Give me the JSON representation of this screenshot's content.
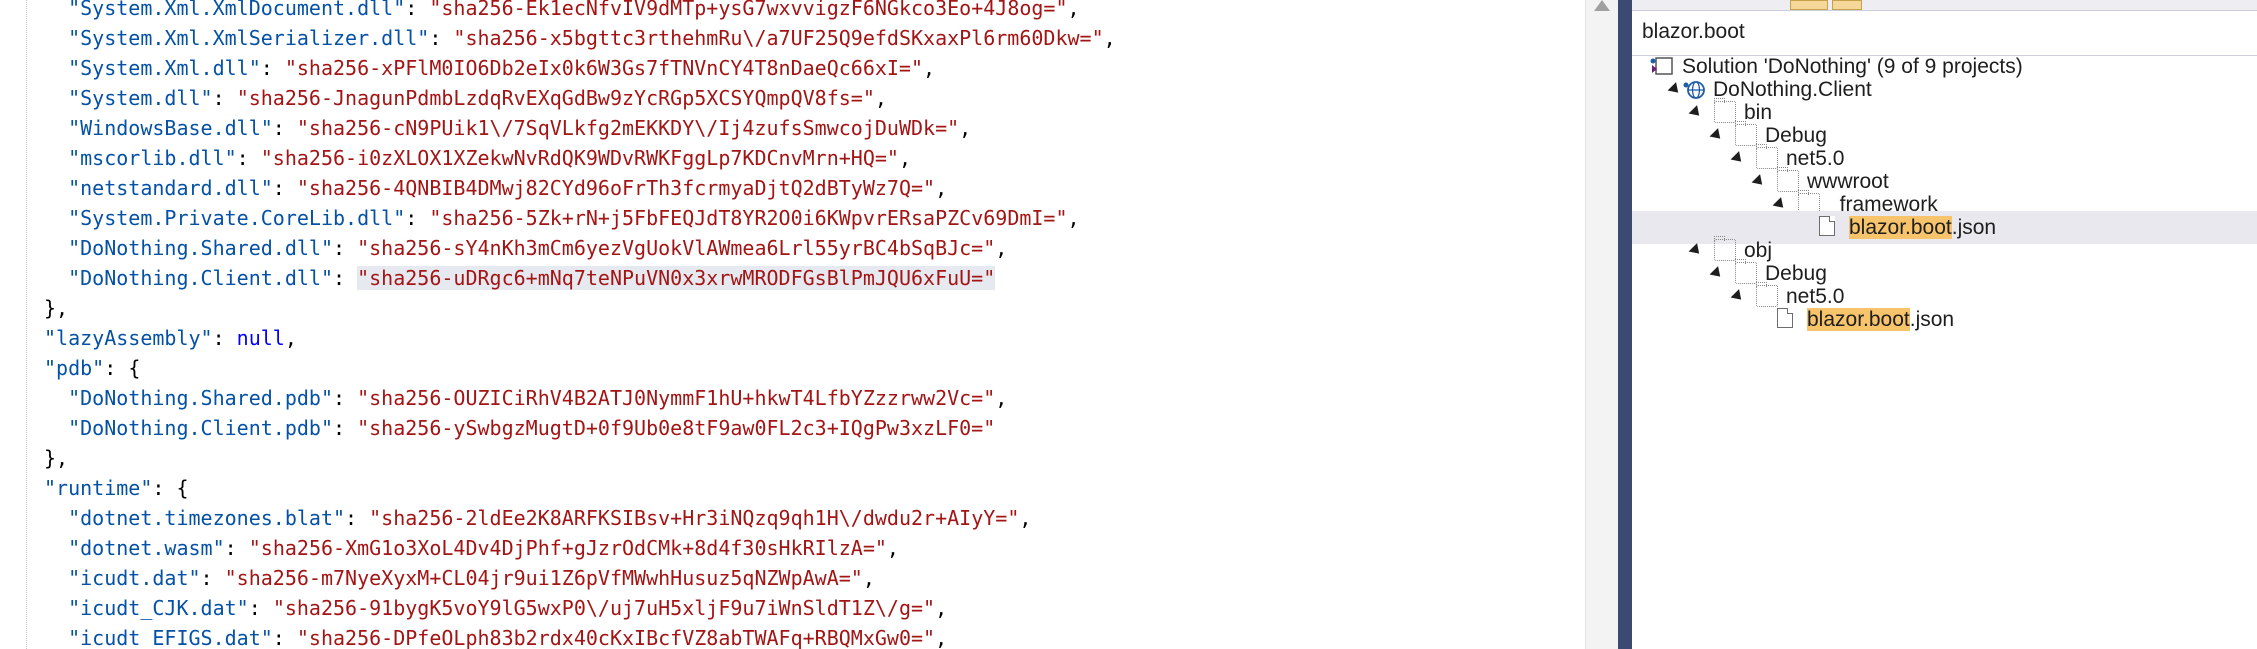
{
  "editor": {
    "lines": [
      {
        "indent": 1,
        "key": "\"System.Xml.XmlDocument.dll\"",
        "value": "\"sha256-Ek1ecNfvIV9dMTp+ysG7wxvvigzF6NGkco3Eo+4J8og=\"",
        "suffix": ","
      },
      {
        "indent": 1,
        "key": "\"System.Xml.XmlSerializer.dll\"",
        "value": "\"sha256-x5bgttc3rthehmRu\\/a7UF25Q9efdSKxaxPl6rm60Dkw=\"",
        "suffix": ","
      },
      {
        "indent": 1,
        "key": "\"System.Xml.dll\"",
        "value": "\"sha256-xPFlM0IO6Db2eIx0k6W3Gs7fTNVnCY4T8nDaeQc66xI=\"",
        "suffix": ","
      },
      {
        "indent": 1,
        "key": "\"System.dll\"",
        "value": "\"sha256-JnagunPdmbLzdqRvEXqGdBw9zYcRGp5XCSYQmpQV8fs=\"",
        "suffix": ","
      },
      {
        "indent": 1,
        "key": "\"WindowsBase.dll\"",
        "value": "\"sha256-cN9PUik1\\/7SqVLkfg2mEKKDY\\/Ij4zufsSmwcojDuWDk=\"",
        "suffix": ","
      },
      {
        "indent": 1,
        "key": "\"mscorlib.dll\"",
        "value": "\"sha256-i0zXLOX1XZekwNvRdQK9WDvRWKFggLp7KDCnvMrn+HQ=\"",
        "suffix": ","
      },
      {
        "indent": 1,
        "key": "\"netstandard.dll\"",
        "value": "\"sha256-4QNBIB4DMwj82CYd96oFrTh3fcrmyaDjtQ2dBTyWz7Q=\"",
        "suffix": ","
      },
      {
        "indent": 1,
        "key": "\"System.Private.CoreLib.dll\"",
        "value": "\"sha256-5Zk+rN+j5FbFEQJdT8YR2O0i6KWpvrERsaPZCv69DmI=\"",
        "suffix": ","
      },
      {
        "indent": 1,
        "key": "\"DoNothing.Shared.dll\"",
        "value": "\"sha256-sY4nKh3mCm6yezVgUokVlAWmea6Lrl55yrBC4bSqBJc=\"",
        "suffix": ","
      },
      {
        "indent": 1,
        "key": "\"DoNothing.Client.dll\"",
        "value": "\"sha256-uDRgc6+mNq7teNPuVN0x3xrwMRODFGsBlPmJQU6xFuU=\"",
        "suffix": "",
        "highlight": true
      },
      {
        "indent": 0,
        "punct": "},"
      },
      {
        "indent": 0,
        "key": "\"lazyAssembly\"",
        "keyword": "null",
        "suffix": ","
      },
      {
        "indent": 0,
        "key": "\"pdb\"",
        "open": "{"
      },
      {
        "indent": 1,
        "key": "\"DoNothing.Shared.pdb\"",
        "value": "\"sha256-OUZICiRhV4B2ATJ0NymmF1hU+hkwT4LfbYZzzrww2Vc=\"",
        "suffix": ","
      },
      {
        "indent": 1,
        "key": "\"DoNothing.Client.pdb\"",
        "value": "\"sha256-ySwbgzMugtD+0f9Ub0e8tF9aw0FL2c3+IQgPw3xzLF0=\"",
        "suffix": ""
      },
      {
        "indent": 0,
        "punct": "},"
      },
      {
        "indent": 0,
        "key": "\"runtime\"",
        "open": "{"
      },
      {
        "indent": 1,
        "key": "\"dotnet.timezones.blat\"",
        "value": "\"sha256-2ldEe2K8ARFKSIBsv+Hr3iNQzq9qh1H\\/dwdu2r+AIyY=\"",
        "suffix": ","
      },
      {
        "indent": 1,
        "key": "\"dotnet.wasm\"",
        "value": "\"sha256-XmG1o3XoL4Dv4DjPhf+gJzrOdCMk+8d4f30sHkRIlzA=\"",
        "suffix": ","
      },
      {
        "indent": 1,
        "key": "\"icudt.dat\"",
        "value": "\"sha256-m7NyeXyxM+CL04jr9ui1Z6pVfMWwhHusuz5qNZWpAwA=\"",
        "suffix": ","
      },
      {
        "indent": 1,
        "key": "\"icudt_CJK.dat\"",
        "value": "\"sha256-91bygK5voY9lG5wxP0\\/uj7uH5xljF9u7iWnSldT1Z\\/g=\"",
        "suffix": ","
      },
      {
        "indent": 1,
        "key": "\"icudt_EFIGS.dat\"",
        "value": "\"sha256-DPfeOLph83b2rdx40cKxIBcfVZ8abTWAFq+RBQMxGw0=\"",
        "suffix": ","
      }
    ]
  },
  "solution_explorer": {
    "search": {
      "value": "blazor.boot"
    },
    "tree": [
      {
        "id": "solution",
        "label": "Solution 'DoNothing' (9 of 9 projects)",
        "icon": "solution-icon",
        "level": 0,
        "expander": false
      },
      {
        "id": "project-client",
        "label": "DoNothing.Client",
        "icon": "web-project-icon",
        "level": 1,
        "expander": true
      },
      {
        "id": "folder-bin",
        "label": "bin",
        "icon": "folder-icon",
        "level": 2,
        "expander": true
      },
      {
        "id": "folder-bin-debug",
        "label": "Debug",
        "icon": "folder-icon",
        "level": 3,
        "expander": true
      },
      {
        "id": "folder-bin-net5",
        "label": "net5.0",
        "icon": "folder-icon",
        "level": 4,
        "expander": true
      },
      {
        "id": "folder-wwwroot",
        "label": "wwwroot",
        "icon": "folder-icon",
        "level": 5,
        "expander": true
      },
      {
        "id": "folder-framework",
        "label": "_framework",
        "icon": "folder-icon",
        "level": 6,
        "expander": true
      },
      {
        "id": "file-boot-bin",
        "match": "blazor.boot",
        "rest": ".json",
        "icon": "json-file-icon",
        "level": 7,
        "expander": false,
        "selected": true
      },
      {
        "id": "folder-obj",
        "label": "obj",
        "icon": "folder-icon",
        "level": 2,
        "expander": true
      },
      {
        "id": "folder-obj-debug",
        "label": "Debug",
        "icon": "folder-icon",
        "level": 3,
        "expander": true
      },
      {
        "id": "folder-obj-net5",
        "label": "net5.0",
        "icon": "folder-icon",
        "level": 4,
        "expander": true
      },
      {
        "id": "file-boot-obj",
        "match": "blazor.boot",
        "rest": ".json",
        "icon": "json-file-icon",
        "level": 5,
        "expander": false
      }
    ]
  }
}
